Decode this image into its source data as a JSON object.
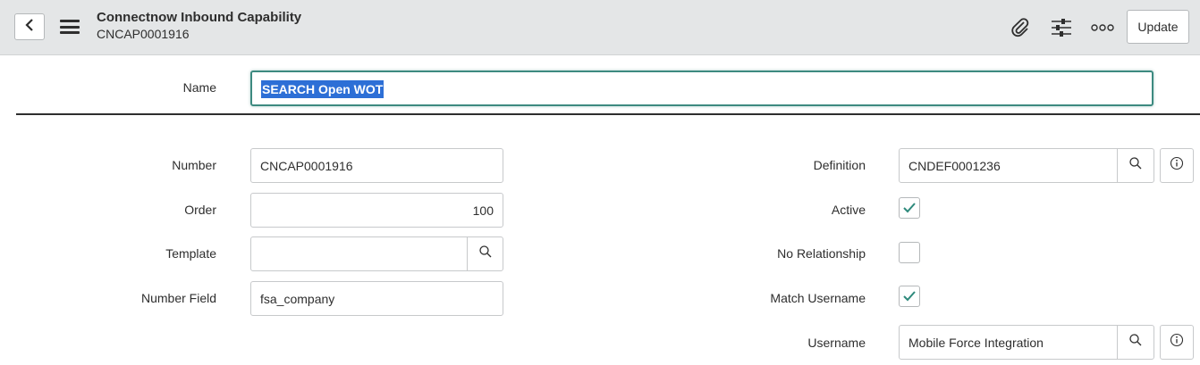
{
  "header": {
    "title": "Connectnow Inbound Capability",
    "subtitle": "CNCAP0001916",
    "update_label": "Update",
    "icons": [
      "back-icon",
      "hamburger-menu-icon",
      "paperclip-icon",
      "sliders-icon",
      "more-icon"
    ]
  },
  "form": {
    "name": {
      "label": "Name",
      "value": "SEARCH Open WOT"
    },
    "number": {
      "label": "Number",
      "value": "CNCAP0001916"
    },
    "order": {
      "label": "Order",
      "value": "100"
    },
    "template": {
      "label": "Template",
      "value": ""
    },
    "number_field": {
      "label": "Number Field",
      "value": "fsa_company"
    },
    "definition": {
      "label": "Definition",
      "value": "CNDEF0001236"
    },
    "active": {
      "label": "Active",
      "checked": true
    },
    "no_relationship": {
      "label": "No Relationship",
      "checked": false
    },
    "match_username": {
      "label": "Match Username",
      "checked": true
    },
    "username": {
      "label": "Username",
      "value": "Mobile Force Integration"
    }
  },
  "colors": {
    "header_bg": "#e4e6e7",
    "accent": "#3d8a80",
    "selection": "#2d6fd6",
    "check": "#2e8a7c"
  }
}
